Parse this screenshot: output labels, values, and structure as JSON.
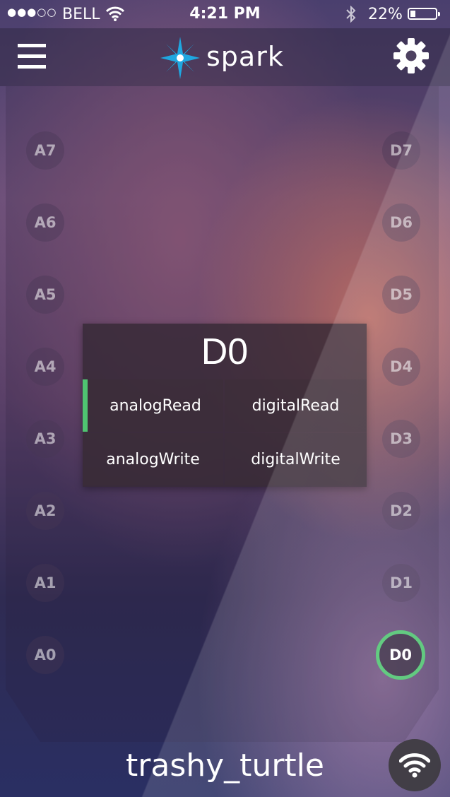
{
  "status_bar": {
    "signal": "●●●○○",
    "carrier": "BELL",
    "time": "4:21 PM",
    "battery_percent": "22%",
    "battery_level": 0.22,
    "icons": [
      "wifi-icon",
      "bluetooth-icon",
      "battery-icon"
    ]
  },
  "nav": {
    "brand": "spark",
    "brand_color": "#1fa7e0",
    "icons": [
      "menu-icon",
      "spark-star-icon",
      "gear-icon"
    ]
  },
  "pins": {
    "analog": [
      "A7",
      "A6",
      "A5",
      "A4",
      "A3",
      "A2",
      "A1",
      "A0"
    ],
    "digital": [
      "D7",
      "D6",
      "D5",
      "D4",
      "D3",
      "D2",
      "D1",
      "D0"
    ],
    "active": "D0",
    "active_color": "#4fc471"
  },
  "popup": {
    "title": "D0",
    "functions": [
      {
        "label": "analogRead",
        "selected": true
      },
      {
        "label": "digitalRead",
        "selected": false
      },
      {
        "label": "analogWrite",
        "selected": false
      },
      {
        "label": "digitalWrite",
        "selected": false
      }
    ]
  },
  "footer": {
    "device_name": "trashy_turtle",
    "icons": [
      "wifi-icon"
    ]
  }
}
